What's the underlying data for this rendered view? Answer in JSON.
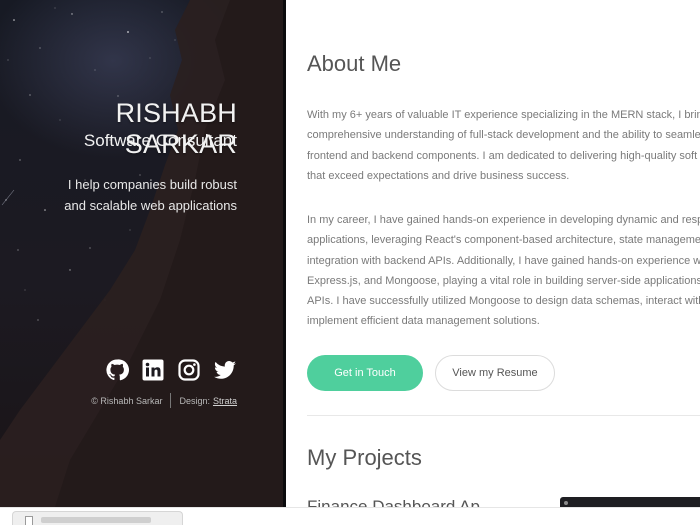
{
  "hero": {
    "name": "RISHABH SARKAR",
    "role": "Software Consultant",
    "tagline_line1": "I help companies build robust",
    "tagline_line2": "and scalable web applications",
    "socials": [
      {
        "name": "github-icon"
      },
      {
        "name": "linkedin-icon"
      },
      {
        "name": "instagram-icon"
      },
      {
        "name": "twitter-icon"
      }
    ],
    "footer_copyright": "© Rishabh Sarkar",
    "footer_design_label": "Design:",
    "footer_design_link": "Strata"
  },
  "about": {
    "heading": "About Me",
    "paragraph1_lines": [
      "With my 6+ years of valuable IT experience specializing in the MERN stack, I bring a",
      "comprehensive understanding of full-stack development and the ability to seamle",
      "frontend and backend components. I am dedicated to delivering high-quality soft",
      "that exceed expectations and drive business success."
    ],
    "paragraph2_lines": [
      "In my career, I have gained hands-on experience in developing dynamic and respo",
      "applications, leveraging React's component-based architecture, state managemen",
      "integration with backend APIs. Additionally, I have gained hands-on experience w",
      "Express.js, and Mongoose, playing a vital role in building server-side applications",
      "APIs. I have successfully utilized Mongoose to design data schemas, interact with I",
      "implement efficient data management solutions."
    ],
    "primary_button": "Get in Touch",
    "secondary_button": "View my Resume"
  },
  "projects": {
    "heading": "My Projects",
    "first_project_title": "Finance Dashboard Ap"
  },
  "colors": {
    "accent": "#4fcf9d",
    "hero_bg": "#1a1a22",
    "heading_text": "#555555",
    "body_text": "#7a7a7a"
  }
}
